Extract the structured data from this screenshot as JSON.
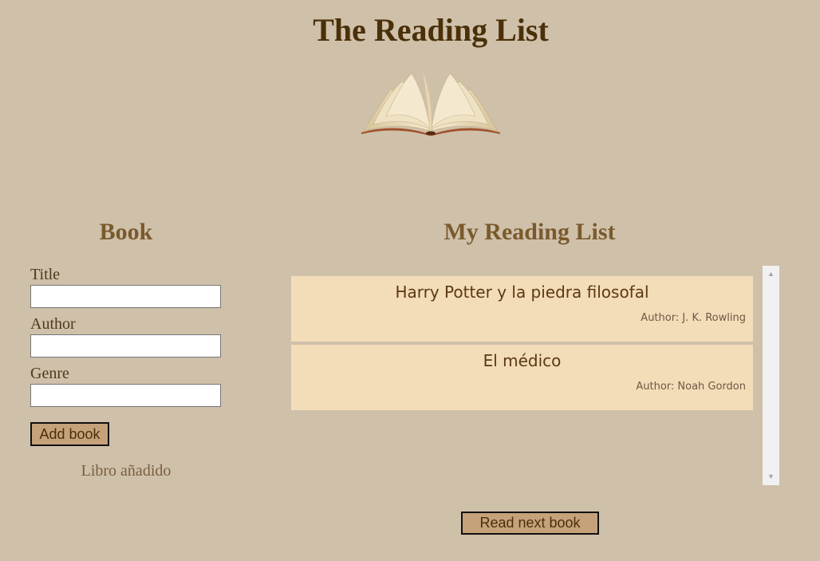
{
  "header": {
    "title": "The Reading List",
    "logo_icon": "open-book-icon"
  },
  "form": {
    "heading": "Book",
    "fields": [
      {
        "label": "Title",
        "value": "",
        "placeholder": ""
      },
      {
        "label": "Author",
        "value": "",
        "placeholder": ""
      },
      {
        "label": "Genre",
        "value": "",
        "placeholder": ""
      }
    ],
    "add_button_label": "Add book",
    "status_message": "Libro añadido"
  },
  "reading_list": {
    "heading": "My Reading List",
    "books": [
      {
        "title": "Harry Potter y la piedra filosofal",
        "author": "Author: J. K. Rowling"
      },
      {
        "title": "El médico",
        "author": "Author: Noah Gordon"
      }
    ],
    "next_button_label": "Read next book"
  },
  "colors": {
    "background": "#cfc0aa",
    "card": "#f3dcb8",
    "button": "#c5a27a",
    "title": "#4a3008",
    "section_heading": "#7a5a2c"
  }
}
